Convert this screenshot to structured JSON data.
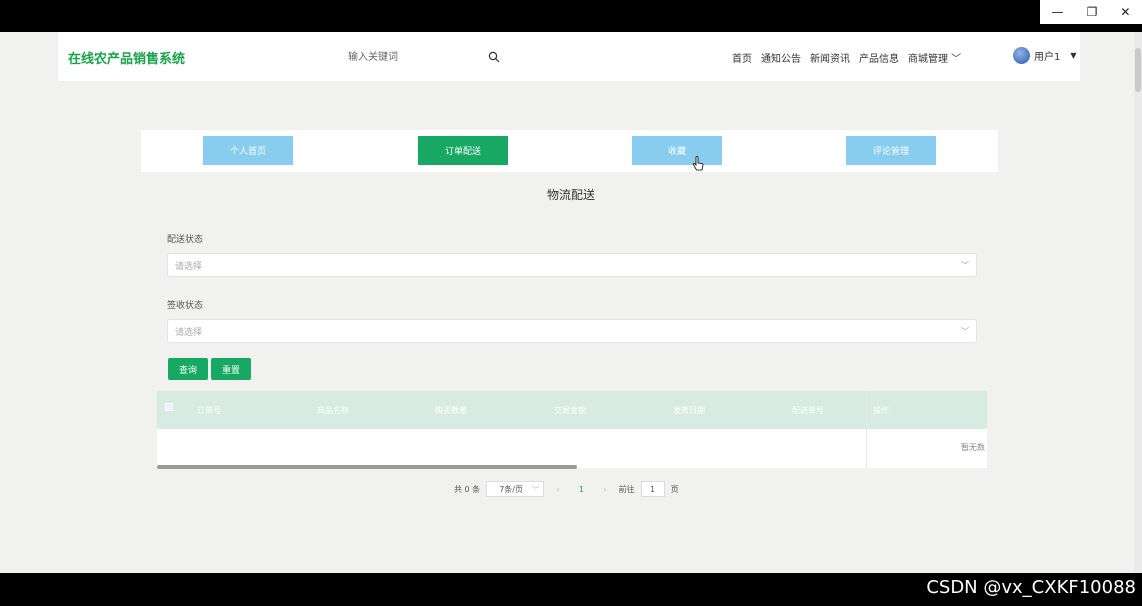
{
  "window": {
    "minimize_glyph": "—",
    "restore_glyph": "❐",
    "close_glyph": "✕"
  },
  "header": {
    "brand": "在线农产品销售系统",
    "search_placeholder": "输入关键词",
    "nav": [
      "首页",
      "通知公告",
      "新闻资讯",
      "产品信息",
      "商城管理 ﹀"
    ],
    "user_name": "用户1"
  },
  "tabs": [
    {
      "label": "个人首页",
      "active": false
    },
    {
      "label": "订单配送",
      "active": true
    },
    {
      "label": "收藏",
      "active": false
    },
    {
      "label": "评论管理",
      "active": false
    }
  ],
  "section_title": "物流配送",
  "filters": {
    "delivery_status_label": "配送状态",
    "delivery_status_placeholder": "请选择",
    "receipt_status_label": "签收状态",
    "receipt_status_placeholder": "请选择"
  },
  "buttons": {
    "query": "查询",
    "reset": "重置"
  },
  "table": {
    "columns": [
      "订单号",
      "商品名称",
      "购买数量",
      "交易金额",
      "发货日期",
      "配送单号",
      "操作"
    ],
    "empty_text": "暂无数"
  },
  "pagination": {
    "total": "共 0 条",
    "page_size": "7条/页",
    "current_page": "1",
    "goto_label": "前往",
    "goto_value": "1",
    "page_suffix": "页"
  },
  "watermark": "CSDN @vx_CXKF10088",
  "colors": {
    "brand_green": "#17a34a",
    "active_tab": "#17a863",
    "inactive_tab": "#89cdee",
    "table_header": "#d7ebe2"
  }
}
